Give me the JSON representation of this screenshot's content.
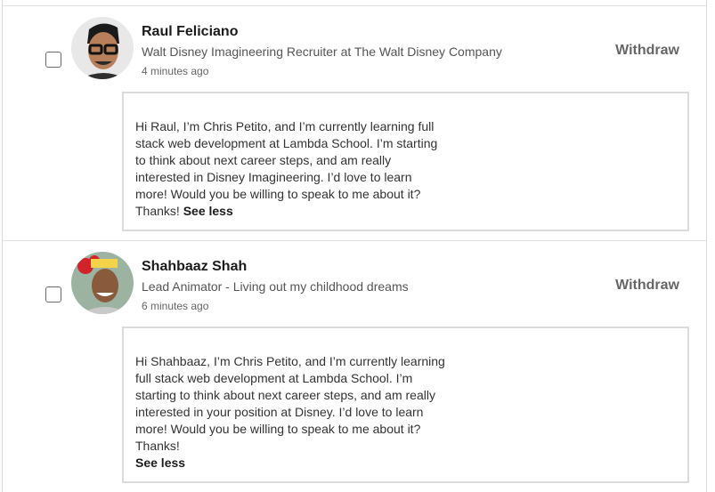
{
  "invitations": [
    {
      "name": "Raul Feliciano",
      "headline": "Walt Disney Imagineering Recruiter at The Walt Disney Company",
      "time": "4 minutes ago",
      "withdraw_label": "Withdraw",
      "message": "Hi Raul, I’m Chris Petito, and I’m currently learning full stack web development at Lambda School. I’m starting to think about next career steps, and am really interested in Disney Imagineering. I’d love to learn more! Would you be willing to speak to me about it? Thanks!",
      "see_less_label": "See less"
    },
    {
      "name": "Shahbaaz Shah",
      "headline": "Lead Animator - Living out my childhood dreams",
      "time": "6 minutes ago",
      "withdraw_label": "Withdraw",
      "message": "Hi Shahbaaz, I’m Chris Petito, and I’m currently learning full stack web development at Lambda School. I’m starting to think about next career steps, and am really interested in your position at Disney. I’d love to learn more! Would you be willing to speak to me about it? Thanks!",
      "see_less_label": "See less"
    }
  ]
}
